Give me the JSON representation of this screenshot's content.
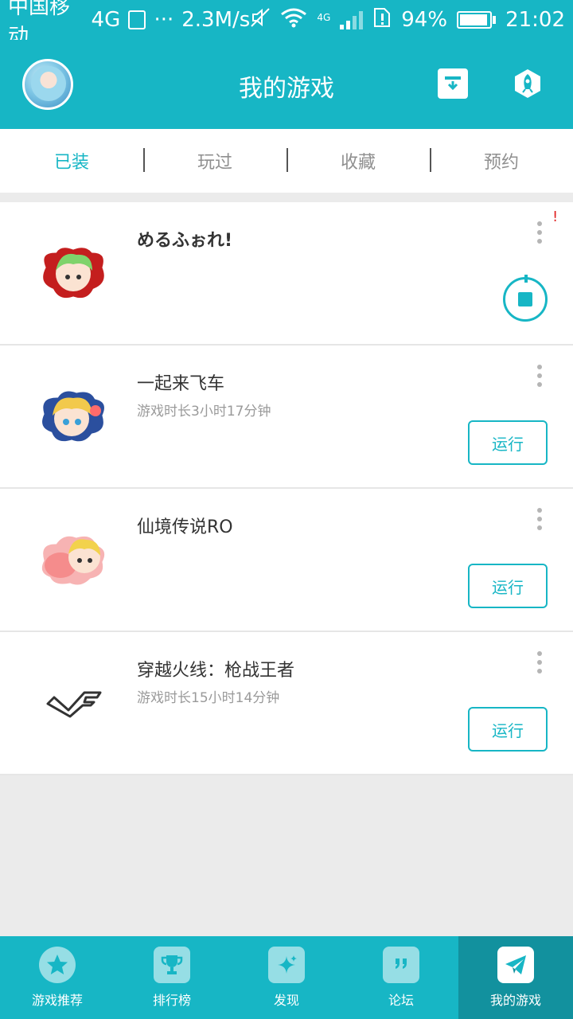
{
  "status_bar": {
    "carrier": "中国移动",
    "network": "4G",
    "speed": "2.3M/s",
    "network_small": "4G",
    "battery": "94%",
    "battery_level": 0.94,
    "time": "21:02"
  },
  "header": {
    "title": "我的游戏",
    "avatar_icon": "user-avatar",
    "download_icon": "download-tray-icon",
    "rocket_icon": "rocket-icon"
  },
  "tabs": [
    {
      "label": "已装",
      "active": true
    },
    {
      "label": "玩过",
      "active": false
    },
    {
      "label": "收藏",
      "active": false
    },
    {
      "label": "预约",
      "active": false
    }
  ],
  "games": [
    {
      "name": "めるふぉれ!",
      "playtime": "",
      "action": "stop",
      "alert": "!"
    },
    {
      "name": "一起来飞车",
      "playtime": "游戏时长3小时17分钟",
      "action": "运行"
    },
    {
      "name": "仙境传说RO",
      "playtime": "",
      "action": "运行"
    },
    {
      "name": "穿越火线：枪战王者",
      "playtime": "游戏时长15小时14分钟",
      "action": "运行"
    }
  ],
  "bottom_nav": [
    {
      "label": "游戏推荐",
      "icon": "star-icon",
      "active": false
    },
    {
      "label": "排行榜",
      "icon": "trophy-icon",
      "active": false
    },
    {
      "label": "发现",
      "icon": "sparkle-icon",
      "active": false
    },
    {
      "label": "论坛",
      "icon": "quote-bubble-icon",
      "active": false
    },
    {
      "label": "我的游戏",
      "icon": "paper-plane-icon",
      "active": true
    }
  ],
  "colors": {
    "primary": "#17b6c5",
    "primary_dark": "#12919e",
    "alert": "#e02222"
  }
}
